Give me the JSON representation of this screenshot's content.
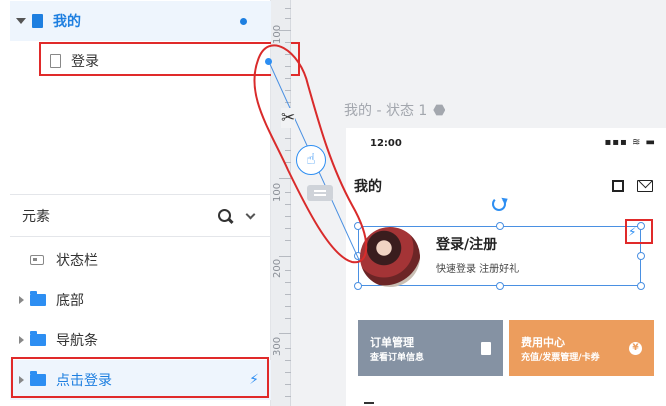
{
  "pages": {
    "root_label": "我的",
    "child_label": "登录"
  },
  "elements_panel": {
    "title": "元素",
    "items": [
      {
        "label": "状态栏",
        "kind": "component"
      },
      {
        "label": "底部",
        "kind": "folder"
      },
      {
        "label": "导航条",
        "kind": "folder"
      },
      {
        "label": "点击登录",
        "kind": "folder",
        "selected": true
      }
    ]
  },
  "ruler": {
    "labels": [
      "100",
      "100",
      "200",
      "300"
    ]
  },
  "canvas": {
    "state_label": "我的 - 状态 1"
  },
  "phone": {
    "time": "12:00",
    "status_icons": "▪▪▪ ≋ ▬",
    "header_title": "我的",
    "login_title": "登录/注册",
    "login_subtitle": "快速登录 注册好礼",
    "cards": [
      {
        "title": "订单管理",
        "subtitle": "查看订单信息"
      },
      {
        "title": "费用中心",
        "subtitle": "充值/发票管理/卡券"
      }
    ]
  },
  "icons": {
    "yen": "¥",
    "bolt": "⚡",
    "hand": "☝",
    "scissors": "✂"
  },
  "colors": {
    "accent": "#1e7fe0",
    "highlight": "#e02a2a",
    "card_order": "#8592a3",
    "card_fee": "#ec9d5d"
  }
}
